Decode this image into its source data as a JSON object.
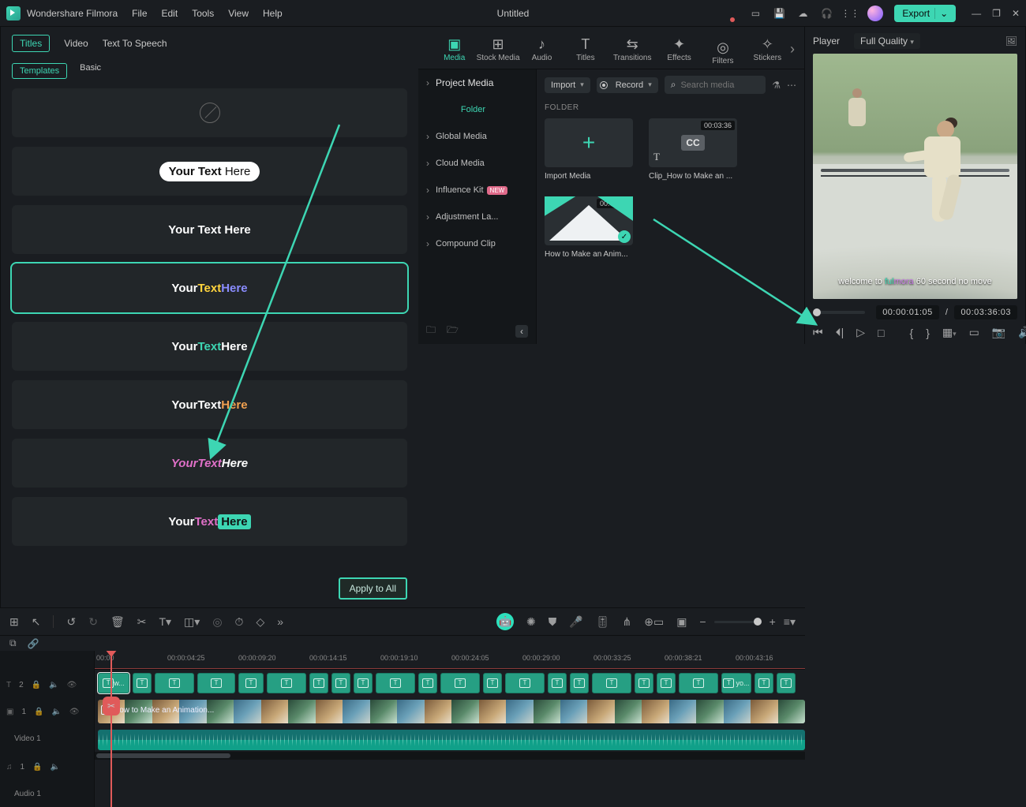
{
  "app": {
    "name": "Wondershare Filmora",
    "title": "Untitled",
    "export_label": "Export"
  },
  "menubar": [
    "File",
    "Edit",
    "Tools",
    "View",
    "Help"
  ],
  "mode_tabs": [
    {
      "label": "Media",
      "active": true
    },
    {
      "label": "Stock Media"
    },
    {
      "label": "Audio"
    },
    {
      "label": "Titles"
    },
    {
      "label": "Transitions"
    },
    {
      "label": "Effects"
    },
    {
      "label": "Filters"
    },
    {
      "label": "Stickers"
    }
  ],
  "sidebar": {
    "header": "Project Media",
    "folder": "Folder",
    "items": [
      {
        "label": "Global Media"
      },
      {
        "label": "Cloud Media"
      },
      {
        "label": "Influence Kit",
        "badge": "NEW"
      },
      {
        "label": "Adjustment La..."
      },
      {
        "label": "Compound Clip"
      }
    ]
  },
  "media_toolbar": {
    "import": "Import",
    "record": "Record",
    "search_placeholder": "Search media"
  },
  "folder_label": "FOLDER",
  "thumbs": [
    {
      "caption": "Import Media",
      "kind": "import"
    },
    {
      "caption": "Clip_How to Make an ...",
      "kind": "cc",
      "duration": "00:03:36"
    },
    {
      "caption": "How to Make an Anim...",
      "kind": "used",
      "duration": "00:03:36"
    }
  ],
  "player": {
    "tab": "Player",
    "quality": "Full Quality",
    "subtitle_pre": "welcome to ",
    "subtitle_fu": "ful",
    "subtitle_mora": "mora",
    "subtitle_post": " 60 second no move",
    "current": "00:00:01:05",
    "sep": "/",
    "total": "00:03:36:03"
  },
  "right": {
    "tabs": [
      "Titles",
      "Video",
      "Text To Speech"
    ],
    "subtabs": [
      "Templates",
      "Basic"
    ],
    "template_text": {
      "y": "Your ",
      "t": "Text ",
      "h": "Here"
    },
    "apply": "Apply to All"
  },
  "timeline": {
    "ticks": [
      "00:00",
      "00:00:04:25",
      "00:00:09:20",
      "00:00:14:15",
      "00:00:19:10",
      "00:00:24:05",
      "00:00:29:00",
      "00:00:33:25",
      "00:00:38:21",
      "00:00:43:16",
      "00:00:"
    ],
    "t2_count": "2",
    "video_track": "Video 1",
    "audio_track": "Audio 1",
    "vclip_label": "How to Make an Animation...",
    "lastclip": "yo..."
  }
}
